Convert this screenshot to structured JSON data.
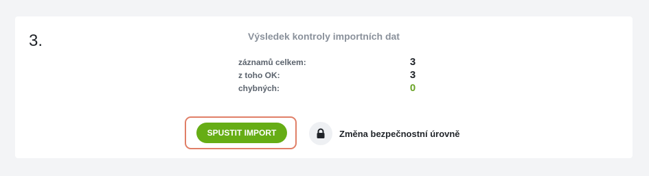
{
  "step": {
    "number": "3."
  },
  "result": {
    "title": "Výsledek kontroly importních dat",
    "stats": [
      {
        "label": "záznamů celkem:",
        "value": "3"
      },
      {
        "label": "z toho OK:",
        "value": "3"
      },
      {
        "label": "chybných:",
        "value": "0"
      }
    ]
  },
  "actions": {
    "import_label": "SPUSTIT IMPORT",
    "security_label": "Změna bezpečnostní úrovně",
    "security_icon": "lock-icon"
  },
  "colors": {
    "accent_green": "#66ad15",
    "ok_green": "#6aa427",
    "highlight_border": "#e07e66"
  }
}
